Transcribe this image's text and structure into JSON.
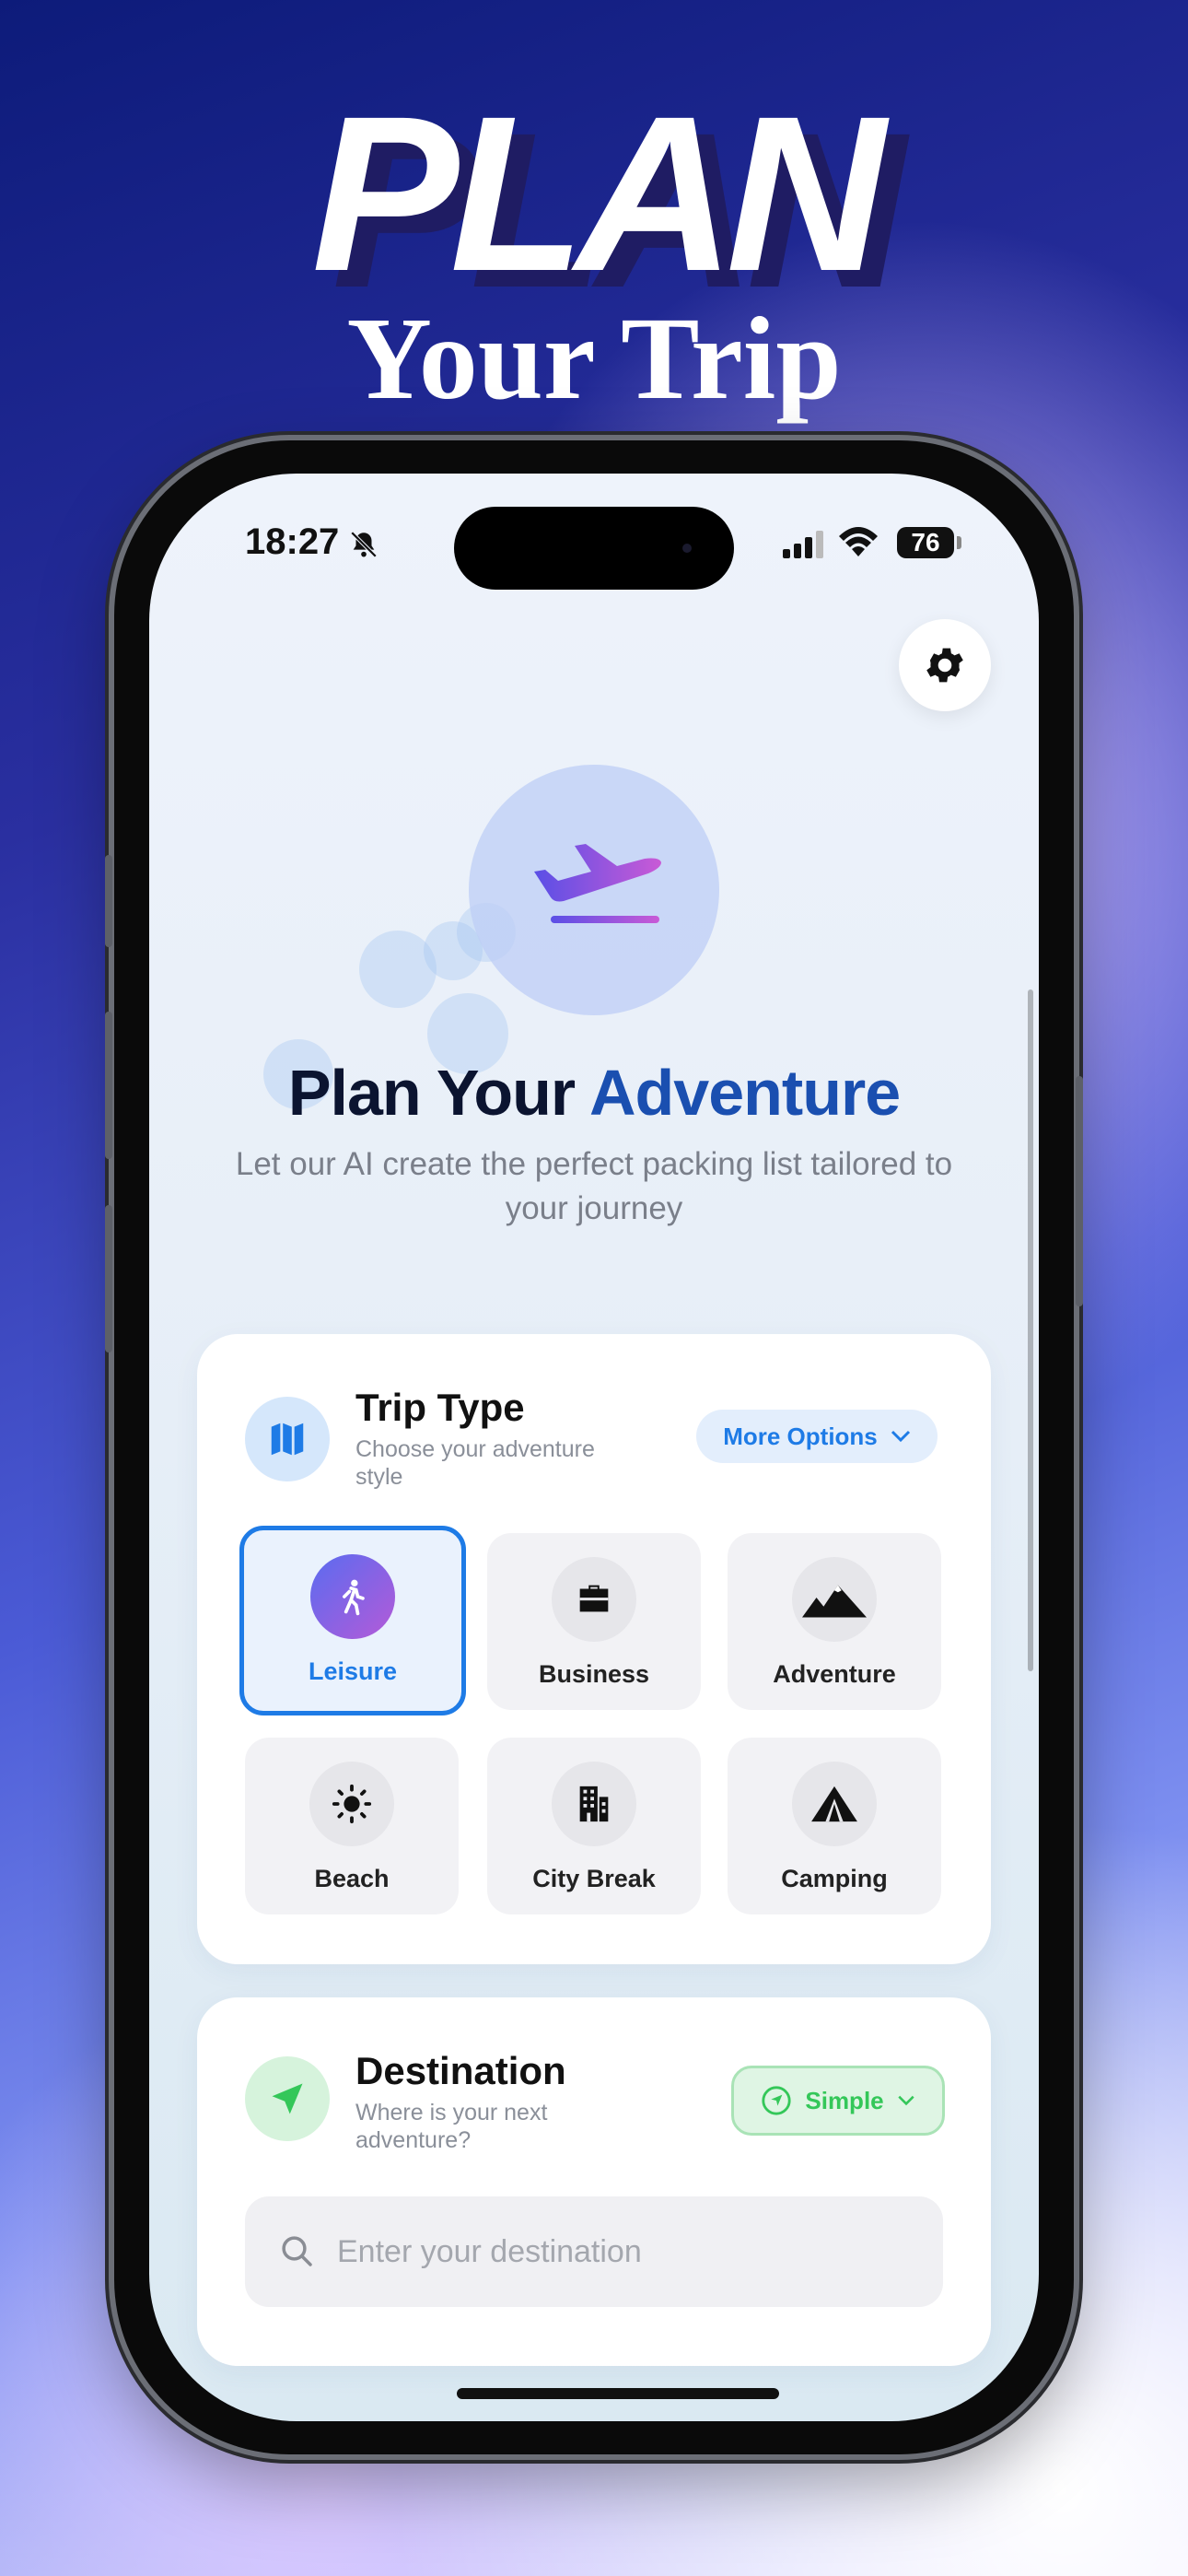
{
  "promo": {
    "headline_1": "PLAN",
    "headline_2": "Your Trip"
  },
  "status_bar": {
    "time": "18:27",
    "battery": "76"
  },
  "hero": {
    "title_part1": "Plan Your ",
    "title_part2": "Adventure",
    "subtitle": "Let our AI create the perfect packing list tailored to your journey"
  },
  "trip_type": {
    "title": "Trip Type",
    "subtitle": "Choose your adventure style",
    "more_options_label": "More Options",
    "selected": "Leisure",
    "options": [
      {
        "label": "Leisure",
        "icon": "walking-person-icon"
      },
      {
        "label": "Business",
        "icon": "briefcase-icon"
      },
      {
        "label": "Adventure",
        "icon": "mountains-icon"
      },
      {
        "label": "Beach",
        "icon": "sun-icon"
      },
      {
        "label": "City Break",
        "icon": "building-icon"
      },
      {
        "label": "Camping",
        "icon": "tent-icon"
      }
    ]
  },
  "destination": {
    "title": "Destination",
    "subtitle": "Where is your next adventure?",
    "mode_label": "Simple",
    "search_placeholder": "Enter your destination"
  },
  "colors": {
    "accent_blue": "#1e7be6",
    "accent_green": "#34c759",
    "title_navy": "#0b1430",
    "title_accent": "#1a4fb0"
  }
}
